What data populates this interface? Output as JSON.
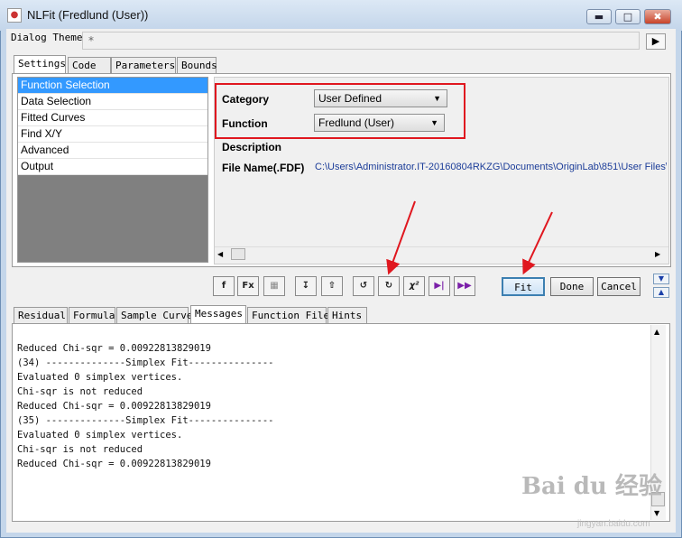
{
  "window": {
    "title": "NLFit (Fredlund (User))",
    "minimize_icon": "minimize-icon",
    "maximize_icon": "maximize-icon",
    "close_icon": "close-icon"
  },
  "dialog_theme": {
    "label": "Dialog Theme",
    "value": "*"
  },
  "top_tabs": [
    "Settings",
    "Code",
    "Parameters",
    "Bounds"
  ],
  "settings_list": [
    "Function Selection",
    "Data Selection",
    "Fitted Curves",
    "Find X/Y",
    "Advanced",
    "Output"
  ],
  "function_selection": {
    "category_label": "Category",
    "category_value": "User Defined",
    "function_label": "Function",
    "function_value": "Fredlund (User)",
    "description_label": "Description",
    "file_label": "File Name(.FDF)",
    "file_value": "C:\\Users\\Administrator.IT-20160804RKZG\\Documents\\OriginLab\\851\\User Files\\"
  },
  "toolbar": {
    "chi2_label": "χ²",
    "fit_label": "Fit",
    "done_label": "Done",
    "cancel_label": "Cancel"
  },
  "bottom_tabs": [
    "Residual",
    "Formula",
    "Sample Curve",
    "Messages",
    "Function File",
    "Hints"
  ],
  "messages": [
    "Reduced Chi-sqr = 0.00922813829019",
    "",
    "(34) --------------Simplex Fit---------------",
    "Evaluated 0 simplex vertices.",
    "Chi-sqr is not reduced",
    "Reduced Chi-sqr = 0.00922813829019",
    "",
    "(35) --------------Simplex Fit---------------",
    "Evaluated 0 simplex vertices.",
    "Chi-sqr is not reduced",
    "Reduced Chi-sqr = 0.00922813829019"
  ],
  "watermark": {
    "text": "Bai du 经验",
    "subtext": "jingyan.baidu.com"
  },
  "colors": {
    "highlight_red": "#e0171f",
    "selection_blue": "#3399ff",
    "path_blue": "#1c3d99"
  }
}
